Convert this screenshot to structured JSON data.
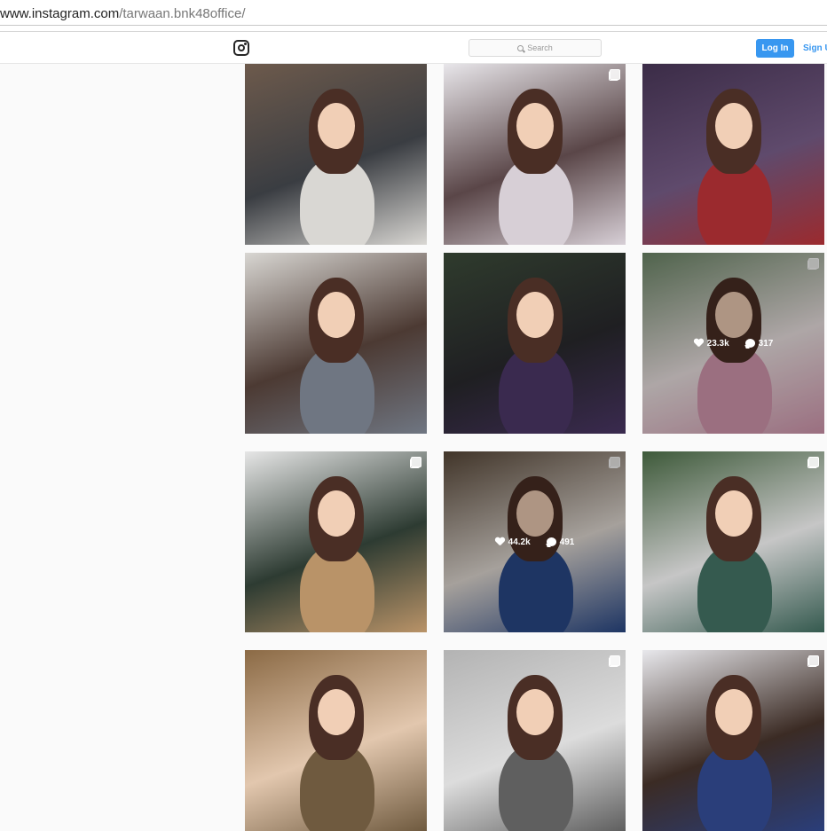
{
  "browser": {
    "url_host": "www.instagram.com",
    "url_path": "/tarwaan.bnk48office/"
  },
  "navbar": {
    "logo_icon": "instagram-logo-icon",
    "search_placeholder": "Search",
    "login_label": "Log In",
    "signup_label": "Sign Up"
  },
  "posts": [
    {
      "multi": false,
      "likes": "",
      "comments": "",
      "colors": [
        "#6d5a4c",
        "#d9d7d3",
        "#3a3d42"
      ]
    },
    {
      "multi": true,
      "likes": "",
      "comments": "",
      "colors": [
        "#e8e6ea",
        "#d7cfd6",
        "#5a4648"
      ]
    },
    {
      "multi": false,
      "likes": "",
      "comments": "",
      "colors": [
        "#3b2c47",
        "#9b2a2e",
        "#5f4a6c"
      ]
    },
    {
      "multi": false,
      "likes": "",
      "comments": "",
      "colors": [
        "#d8d6d2",
        "#6f7682",
        "#4c3a33"
      ]
    },
    {
      "multi": false,
      "likes": "",
      "comments": "",
      "colors": [
        "#2f3b2d",
        "#3a2a4f",
        "#1f1f22"
      ]
    },
    {
      "multi": true,
      "likes": "23.3k",
      "comments": "317",
      "colors": [
        "#6f8a6a",
        "#d79ab2",
        "#f1e7e7"
      ]
    },
    {
      "multi": true,
      "likes": "",
      "comments": "",
      "colors": [
        "#e6e6e6",
        "#b99368",
        "#2d3b32"
      ]
    },
    {
      "multi": true,
      "likes": "44.2k",
      "comments": "491",
      "colors": [
        "#5b4a3a",
        "#2a4a8a",
        "#e6dfd8"
      ]
    },
    {
      "multi": true,
      "likes": "",
      "comments": "",
      "colors": [
        "#3e5a3a",
        "#355a4f",
        "#c6c6c6"
      ]
    },
    {
      "multi": false,
      "likes": "",
      "comments": "",
      "colors": [
        "#8b6a45",
        "#6f5a3f",
        "#e2c7ae"
      ]
    },
    {
      "multi": true,
      "likes": "",
      "comments": "",
      "colors": [
        "#b3b3b3",
        "#5f5f5f",
        "#dcdcdc"
      ]
    },
    {
      "multi": true,
      "likes": "",
      "comments": "",
      "colors": [
        "#e8e8ec",
        "#2a3e7a",
        "#3b2b24"
      ]
    }
  ]
}
